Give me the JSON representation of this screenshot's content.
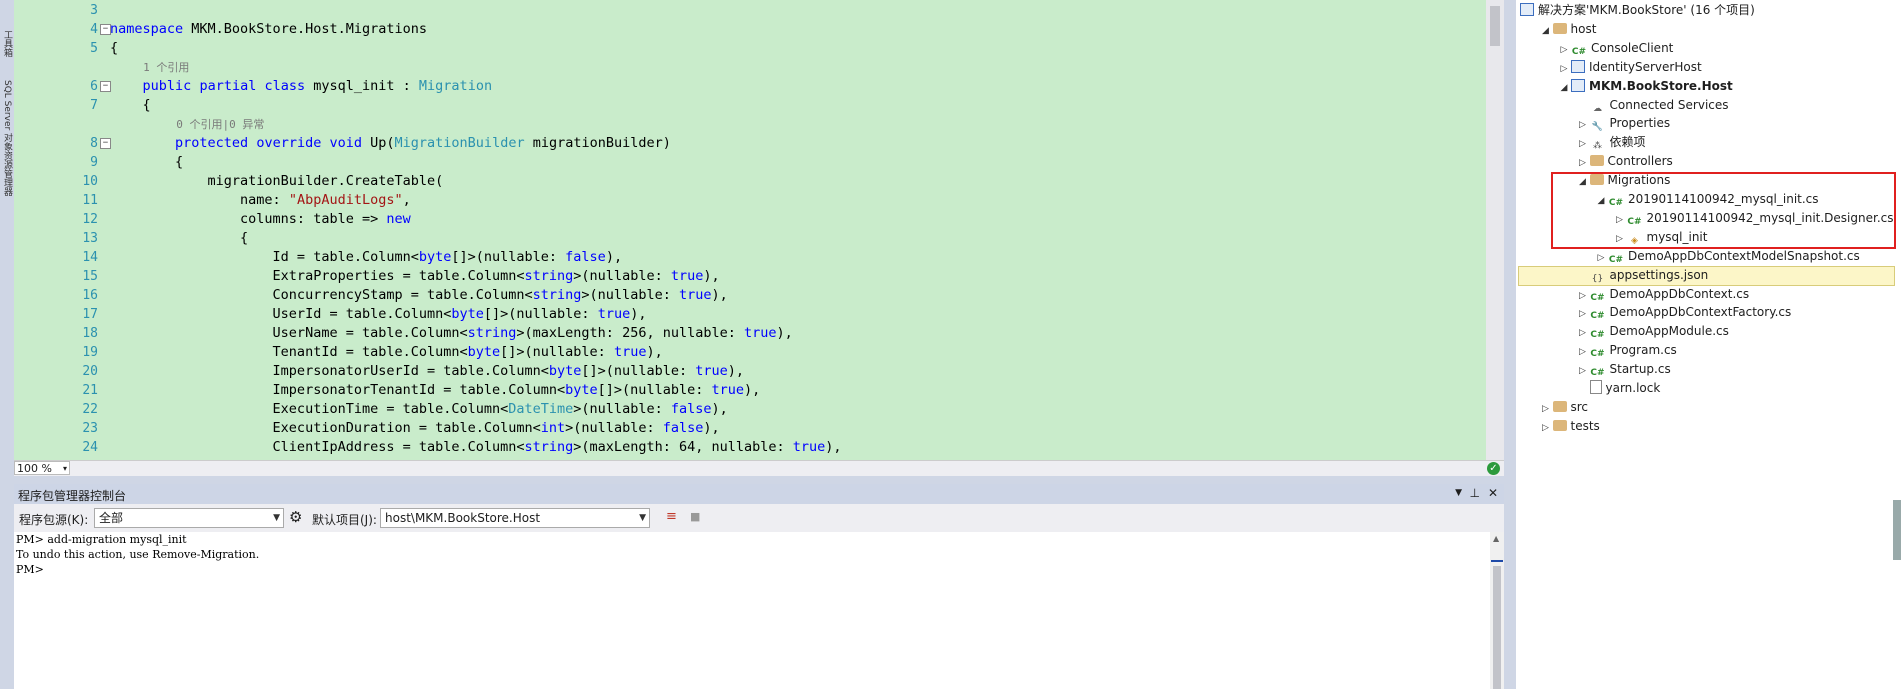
{
  "left_strip": {
    "tabs": [
      "工具箱",
      "SQL Server 对象资源管理器"
    ]
  },
  "editor": {
    "lines": [
      {
        "num": "3",
        "code": ""
      },
      {
        "num": "4",
        "code": "namespace MKM.BookStore.Host.Migrations"
      },
      {
        "num": "5",
        "code": "{"
      },
      {
        "hint": "1 个引用"
      },
      {
        "num": "6",
        "code": "    public partial class mysql_init : Migration"
      },
      {
        "num": "7",
        "code": "    {"
      },
      {
        "hint": "0 个引用|0 异常"
      },
      {
        "num": "8",
        "code": "        protected override void Up(MigrationBuilder migrationBuilder)"
      },
      {
        "num": "9",
        "code": "        {"
      },
      {
        "num": "10",
        "code": "            migrationBuilder.CreateTable("
      },
      {
        "num": "11",
        "code": "                name: \"AbpAuditLogs\","
      },
      {
        "num": "12",
        "code": "                columns: table => new"
      },
      {
        "num": "13",
        "code": "                {"
      },
      {
        "num": "14",
        "code": "                    Id = table.Column<byte[]>(nullable: false),"
      },
      {
        "num": "15",
        "code": "                    ExtraProperties = table.Column<string>(nullable: true),"
      },
      {
        "num": "16",
        "code": "                    ConcurrencyStamp = table.Column<string>(nullable: true),"
      },
      {
        "num": "17",
        "code": "                    UserId = table.Column<byte[]>(nullable: true),"
      },
      {
        "num": "18",
        "code": "                    UserName = table.Column<string>(maxLength: 256, nullable: true),"
      },
      {
        "num": "19",
        "code": "                    TenantId = table.Column<byte[]>(nullable: true),"
      },
      {
        "num": "20",
        "code": "                    ImpersonatorUserId = table.Column<byte[]>(nullable: true),"
      },
      {
        "num": "21",
        "code": "                    ImpersonatorTenantId = table.Column<byte[]>(nullable: true),"
      },
      {
        "num": "22",
        "code": "                    ExecutionTime = table.Column<DateTime>(nullable: false),"
      },
      {
        "num": "23",
        "code": "                    ExecutionDuration = table.Column<int>(nullable: false),"
      },
      {
        "num": "24",
        "code": "                    ClientIpAddress = table.Column<string>(maxLength: 64, nullable: true),"
      }
    ],
    "zoom": "100 %"
  },
  "package_manager": {
    "title": "程序包管理器控制台",
    "source_label": "程序包源(K):",
    "source_value": "全部",
    "default_project_label": "默认项目(J):",
    "default_project_value": "host\\MKM.BookStore.Host",
    "console_lines": [
      "PM> add-migration mysql_init",
      "To undo this action, use Remove-Migration.",
      "PM>"
    ]
  },
  "solution_explorer": {
    "items": [
      {
        "label": "解决方案'MKM.BookStore' (16 个项目)",
        "indent": 0,
        "expander": "",
        "icon": "solution"
      },
      {
        "label": "host",
        "indent": 1,
        "expander": "◢",
        "icon": "folder"
      },
      {
        "label": "ConsoleClient",
        "indent": 2,
        "expander": "▷",
        "icon": "csproj"
      },
      {
        "label": "IdentityServerHost",
        "indent": 2,
        "expander": "▷",
        "icon": "proj"
      },
      {
        "label": "MKM.BookStore.Host",
        "indent": 2,
        "expander": "◢",
        "icon": "proj",
        "bold": true
      },
      {
        "label": "Connected Services",
        "indent": 3,
        "expander": "",
        "icon": "cloud"
      },
      {
        "label": "Properties",
        "indent": 3,
        "expander": "▷",
        "icon": "wrench"
      },
      {
        "label": "依赖项",
        "indent": 3,
        "expander": "▷",
        "icon": "dep"
      },
      {
        "label": "Controllers",
        "indent": 3,
        "expander": "▷",
        "icon": "folder"
      },
      {
        "label": "Migrations",
        "indent": 3,
        "expander": "◢",
        "icon": "folder"
      },
      {
        "label": "20190114100942_mysql_init.cs",
        "indent": 4,
        "expander": "◢",
        "icon": "cs"
      },
      {
        "label": "20190114100942_mysql_init.Designer.cs",
        "indent": 5,
        "expander": "▷",
        "icon": "cs"
      },
      {
        "label": "mysql_init",
        "indent": 5,
        "expander": "▷",
        "icon": "module"
      },
      {
        "label": "DemoAppDbContextModelSnapshot.cs",
        "indent": 4,
        "expander": "▷",
        "icon": "cs"
      },
      {
        "label": "appsettings.json",
        "indent": 3,
        "expander": "",
        "icon": "json"
      },
      {
        "label": "DemoAppDbContext.cs",
        "indent": 3,
        "expander": "▷",
        "icon": "cs"
      },
      {
        "label": "DemoAppDbContextFactory.cs",
        "indent": 3,
        "expander": "▷",
        "icon": "cs"
      },
      {
        "label": "DemoAppModule.cs",
        "indent": 3,
        "expander": "▷",
        "icon": "cs"
      },
      {
        "label": "Program.cs",
        "indent": 3,
        "expander": "▷",
        "icon": "cs"
      },
      {
        "label": "Startup.cs",
        "indent": 3,
        "expander": "▷",
        "icon": "cs"
      },
      {
        "label": "yarn.lock",
        "indent": 3,
        "expander": "",
        "icon": "file"
      },
      {
        "label": "src",
        "indent": 1,
        "expander": "▷",
        "icon": "folder"
      },
      {
        "label": "tests",
        "indent": 1,
        "expander": "▷",
        "icon": "folder"
      }
    ]
  },
  "colors": {
    "editor_bg": "#c9eccb",
    "keyword": "#0000ff",
    "type": "#2b91af",
    "string": "#a31515",
    "highlight_box": "#e0201f"
  }
}
